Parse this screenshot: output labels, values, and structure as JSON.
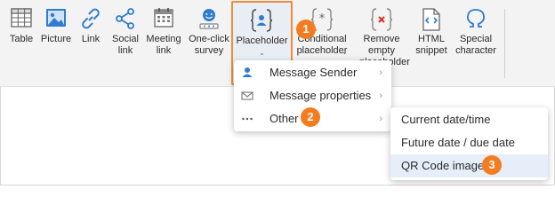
{
  "ribbon": {
    "table_label": "Table",
    "picture_label": "Picture",
    "link_label": "Link",
    "social_link_label": "Social\nlink",
    "meeting_link_label": "Meeting\nlink",
    "oneclick_label": "One-click\nsurvey",
    "placeholder_label": "Placeholder",
    "conditional_label": "Conditional\nplaceholder",
    "remove_label": "Remove\nempty\nplaceholder",
    "html_label": "HTML\nsnippet",
    "special_label": "Special\ncharacter"
  },
  "menu": {
    "items": [
      {
        "label": "Message Sender"
      },
      {
        "label": "Message properties"
      },
      {
        "label": "Other"
      }
    ]
  },
  "submenu": {
    "items": [
      {
        "label": "Current date/time"
      },
      {
        "label": "Future date / due date"
      },
      {
        "label": "QR Code image"
      }
    ]
  },
  "badges": {
    "one": "1",
    "two": "2",
    "three": "3"
  },
  "colors": {
    "accent": "#2f7cd0",
    "badge": "#f47c20",
    "highlight": "#e5eef9",
    "red": "#d93025"
  }
}
